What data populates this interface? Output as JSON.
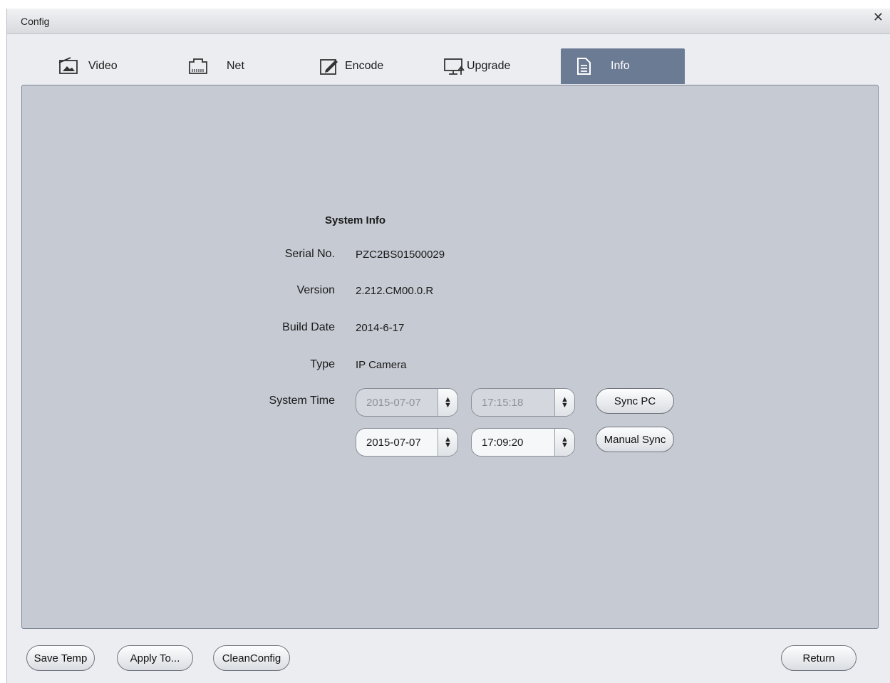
{
  "window": {
    "title": "Config",
    "close_glyph": "✕"
  },
  "tabs": [
    {
      "label": "Video",
      "icon": "picture-icon"
    },
    {
      "label": "Net",
      "icon": "network-port-icon"
    },
    {
      "label": "Encode",
      "icon": "edit-icon"
    },
    {
      "label": "Upgrade",
      "icon": "monitor-upload-icon"
    },
    {
      "label": "Info",
      "icon": "document-icon",
      "active": true
    }
  ],
  "info": {
    "heading": "System Info",
    "serial_label": "Serial No.",
    "serial_value": "PZC2BS01500029",
    "version_label": "Version",
    "version_value": "2.212.CM00.0.R",
    "build_label": "Build Date",
    "build_value": "2014-6-17",
    "type_label": "Type",
    "type_value": "IP Camera",
    "system_time_label": "System Time",
    "pc_date": "2015-07-07",
    "pc_time": "17:15:18",
    "device_date": "2015-07-07",
    "device_time": "17:09:20",
    "sync_pc_label": "Sync PC",
    "manual_sync_label": "Manual Sync"
  },
  "footer": {
    "save_temp": "Save Temp",
    "apply_to": "Apply To...",
    "clean_config": "CleanConfig",
    "return": "Return"
  },
  "colors": {
    "active_tab": "#6c7b94",
    "panel_bg": "#c6cad2",
    "window_bg": "#ebedf1"
  }
}
